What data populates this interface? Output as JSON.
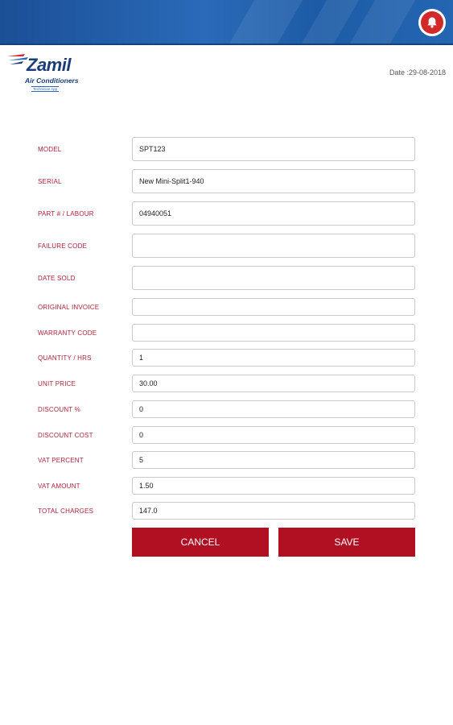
{
  "header": {
    "notification_icon": "bell-icon",
    "bar_color": "#1f5ca8",
    "bell_color": "#d22a2a"
  },
  "logo": {
    "name": "Zamil",
    "subtitle": "Air Conditioners",
    "tagline": "Technician App"
  },
  "date_text": "Date :29-08-2018",
  "form": {
    "fields": [
      {
        "label": "MODEL",
        "value": "SPT123",
        "placeholder": ""
      },
      {
        "label": "SERIAL",
        "value": "New Mini-Split1-940",
        "placeholder": ""
      },
      {
        "label": "PART # / LABOUR",
        "value": "04940051",
        "placeholder": ""
      },
      {
        "label": "FAILURE CODE",
        "value": "",
        "placeholder": ""
      },
      {
        "label": "DATE SOLD",
        "value": "",
        "placeholder": ""
      },
      {
        "label": "ORIGINAL INVOICE",
        "value": "",
        "placeholder": ""
      },
      {
        "label": "WARRANTY CODE",
        "value": "",
        "placeholder": ""
      },
      {
        "label": "QUANTITY / HRS",
        "value": "1",
        "placeholder": ""
      },
      {
        "label": "UNIT PRICE",
        "value": "30.00",
        "placeholder": ""
      },
      {
        "label": "DISCOUNT %",
        "value": "0",
        "placeholder": ""
      },
      {
        "label": "DISCOUNT COST",
        "value": "0",
        "placeholder": ""
      },
      {
        "label": "VAT PERCENT",
        "value": "5",
        "placeholder": ""
      },
      {
        "label": "VAT AMOUNT",
        "value": "1.50",
        "placeholder": ""
      },
      {
        "label": "TOTAL CHARGES",
        "value": "147.0",
        "placeholder": ""
      }
    ],
    "cancel_label": "CANCEL",
    "save_label": "SAVE",
    "button_color": "#b01021"
  }
}
